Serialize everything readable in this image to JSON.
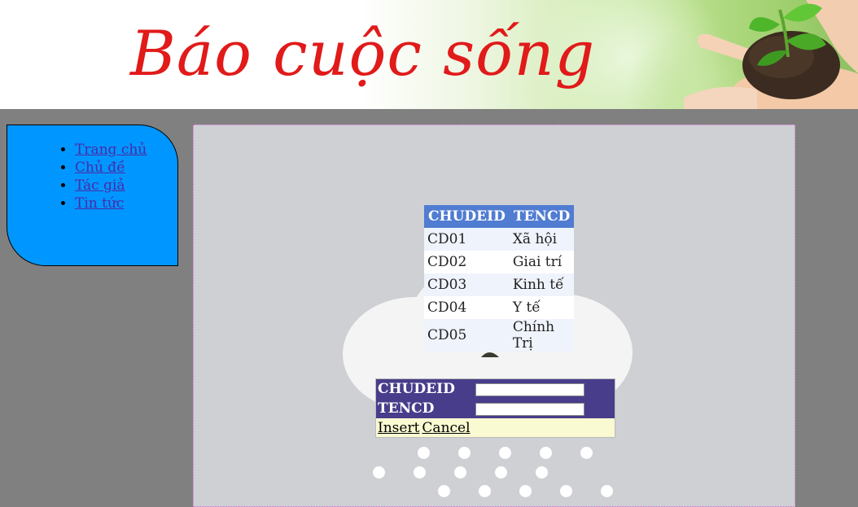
{
  "banner": {
    "title": "Báo cuộc sống"
  },
  "sidebar": {
    "items": [
      {
        "label": "Trang chủ"
      },
      {
        "label": "Chủ đề"
      },
      {
        "label": "Tác giả"
      },
      {
        "label": "Tin tức"
      }
    ]
  },
  "grid": {
    "headers": [
      "CHUDEID",
      "TENCD"
    ],
    "rows": [
      [
        "CD01",
        "Xã hội"
      ],
      [
        "CD02",
        "Giai trí"
      ],
      [
        "CD03",
        "Kinh tế"
      ],
      [
        "CD04",
        "Y tế"
      ],
      [
        "CD05",
        "Chính Trị"
      ]
    ]
  },
  "form": {
    "fields": [
      {
        "label": "CHUDEID",
        "value": ""
      },
      {
        "label": "TENCD",
        "value": ""
      }
    ],
    "insert_label": "Insert",
    "cancel_label": "Cancel"
  },
  "colors": {
    "background": "#808080",
    "sidebar": "#0096ff",
    "content": "#cfd0d4",
    "grid_header": "#507cd1",
    "form_header": "#483d8b",
    "form_footer": "#fafad2",
    "banner_title": "#e11a1a"
  },
  "icons": [
    "hand-with-seedling-icon",
    "sad-cloud-icon"
  ]
}
